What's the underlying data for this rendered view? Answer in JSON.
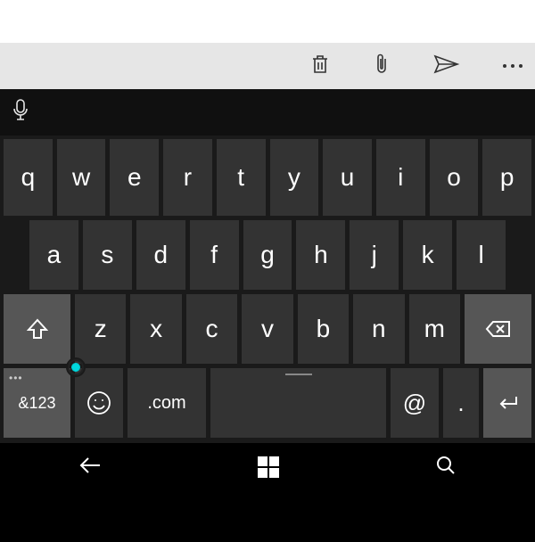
{
  "toolbar": {
    "delete_icon": "trash-icon",
    "attach_icon": "paperclip-icon",
    "send_icon": "send-icon",
    "more_icon": "more-icon"
  },
  "suggestion_strip": {
    "voice_icon": "microphone-icon"
  },
  "keyboard": {
    "row1": [
      "q",
      "w",
      "e",
      "r",
      "t",
      "y",
      "u",
      "i",
      "o",
      "p"
    ],
    "row2": [
      "a",
      "s",
      "d",
      "f",
      "g",
      "h",
      "j",
      "k",
      "l"
    ],
    "row3_letters": [
      "z",
      "x",
      "c",
      "v",
      "b",
      "n",
      "m"
    ],
    "shift_icon": "shift-icon",
    "backspace_icon": "backspace-icon",
    "numsym_label": "&123",
    "emoji_label": "☺",
    "com_label": ".com",
    "at_label": "@",
    "period_label": ".",
    "enter_icon": "enter-icon",
    "space_label": ""
  },
  "navbar": {
    "back_icon": "back-icon",
    "start_icon": "windows-start-icon",
    "search_icon": "search-icon"
  }
}
